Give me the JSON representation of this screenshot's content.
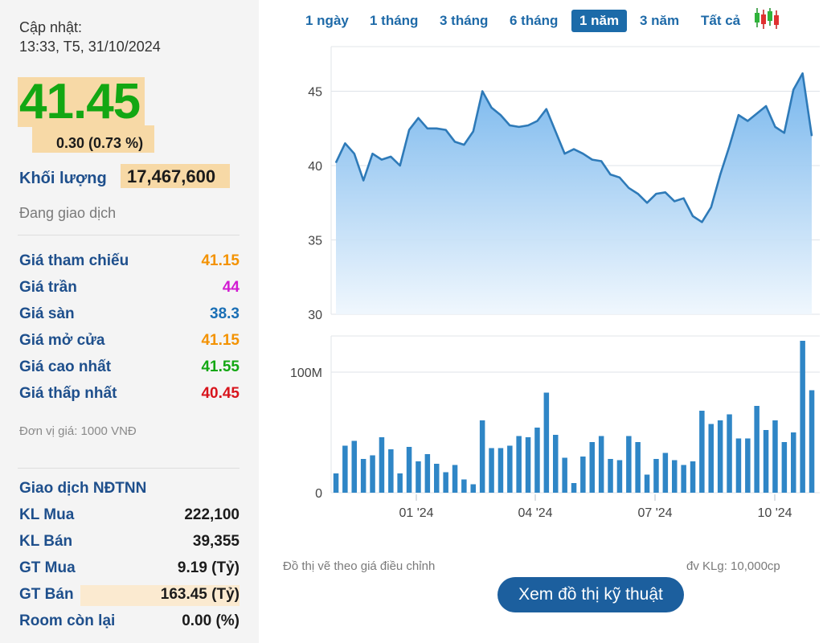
{
  "update": {
    "label": "Cập nhật:",
    "time": "13:33, T5, 31/10/2024"
  },
  "price": {
    "value": "41.45",
    "change": "0.30 (0.73 %)"
  },
  "volume": {
    "label": "Khối lượng",
    "value": "17,467,600"
  },
  "status": "Đang giao dịch",
  "stats": [
    {
      "label": "Giá tham chiếu",
      "value": "41.15",
      "color": "#f39200"
    },
    {
      "label": "Giá trần",
      "value": "44",
      "color": "#d21bd2"
    },
    {
      "label": "Giá sàn",
      "value": "38.3",
      "color": "#1a6fb5"
    },
    {
      "label": "Giá mở cửa",
      "value": "41.15",
      "color": "#f39200"
    },
    {
      "label": "Giá cao nhất",
      "value": "41.55",
      "color": "#13a713"
    },
    {
      "label": "Giá thấp nhất",
      "value": "40.45",
      "color": "#d8141c"
    }
  ],
  "unit_note": "Đơn vị giá: 1000 VNĐ",
  "foreign": {
    "title": "Giao dịch NĐTNN",
    "rows": [
      {
        "label": "KL Mua",
        "value": "222,100"
      },
      {
        "label": "KL Bán",
        "value": "39,355"
      },
      {
        "label": "GT Mua",
        "value": "9.19 (Tỷ)"
      },
      {
        "label": "GT Bán",
        "value": "163.45 (Tỷ)"
      },
      {
        "label": "Room còn lại",
        "value": "0.00 (%)"
      }
    ]
  },
  "tabs": [
    {
      "label": "1 ngày",
      "active": false
    },
    {
      "label": "1 tháng",
      "active": false
    },
    {
      "label": "3 tháng",
      "active": false
    },
    {
      "label": "6 tháng",
      "active": false
    },
    {
      "label": "1 năm",
      "active": true
    },
    {
      "label": "3 năm",
      "active": false
    },
    {
      "label": "Tất cả",
      "active": false
    }
  ],
  "candle_icon": "candlestick-chart-icon",
  "notes": {
    "left": "Đồ thị vẽ theo giá điều chỉnh",
    "right": "đv KLg: 10,000cp"
  },
  "tech_button": "Xem đồ thị kỹ thuật",
  "chart_data": [
    {
      "type": "area",
      "ylim": [
        30,
        48
      ],
      "y_ticks": [
        "30",
        "35",
        "40",
        "45"
      ],
      "x_ticks": [
        "01 '24",
        "04 '24",
        "07 '24",
        "10 '24"
      ],
      "grid": true,
      "colors": {
        "line": "#2e7ab8",
        "fill_top": "#6fb2ec",
        "fill_bottom": "#eef6fd"
      },
      "values": [
        40.2,
        41.5,
        40.8,
        39.0,
        40.8,
        40.4,
        40.6,
        40.0,
        42.4,
        43.2,
        42.5,
        42.5,
        42.4,
        41.6,
        41.4,
        42.3,
        45.0,
        43.9,
        43.4,
        42.7,
        42.6,
        42.7,
        43.0,
        43.8,
        42.3,
        40.8,
        41.1,
        40.8,
        40.4,
        40.3,
        39.4,
        39.2,
        38.5,
        38.1,
        37.5,
        38.1,
        38.2,
        37.6,
        37.8,
        36.6,
        36.2,
        37.2,
        39.4,
        41.3,
        43.4,
        43.0,
        43.5,
        44.0,
        42.6,
        42.2,
        45.1,
        46.2,
        42.0
      ]
    },
    {
      "type": "bar",
      "ylim": [
        0,
        130
      ],
      "y_ticks": [
        "0",
        "100M"
      ],
      "x_ticks": [
        "01 '24",
        "04 '24",
        "07 '24",
        "10 '24"
      ],
      "grid": true,
      "colors": {
        "bar": "#2f86c6"
      },
      "values": [
        16,
        39,
        43,
        28,
        31,
        46,
        36,
        16,
        38,
        26,
        32,
        24,
        17,
        23,
        11,
        7,
        60,
        37,
        37,
        39,
        47,
        46,
        54,
        83,
        48,
        29,
        8,
        30,
        42,
        47,
        28,
        27,
        47,
        42,
        15,
        28,
        33,
        27,
        23,
        26,
        68,
        57,
        60,
        65,
        45,
        45,
        72,
        52,
        60,
        42,
        50,
        126,
        85
      ]
    }
  ]
}
